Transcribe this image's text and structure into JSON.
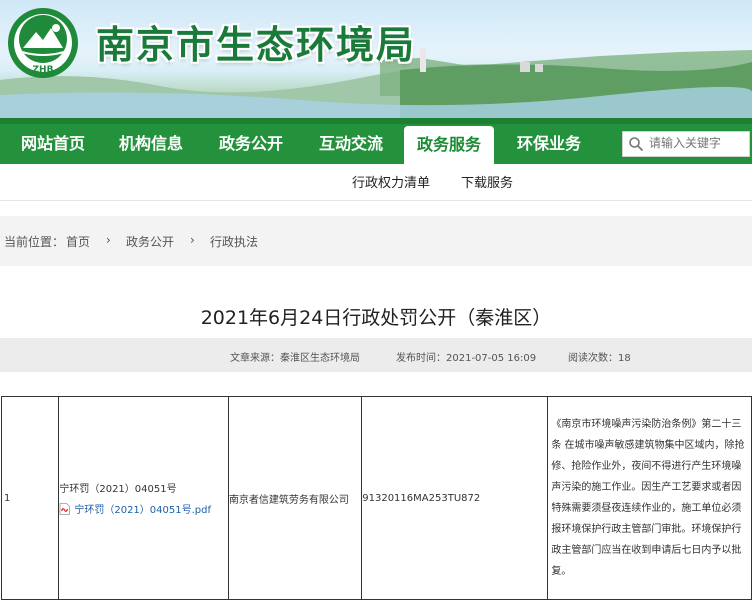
{
  "header": {
    "title": "南京市生态环境局",
    "logo_text": "ZHB"
  },
  "nav": {
    "items": [
      {
        "label": "网站首页"
      },
      {
        "label": "机构信息"
      },
      {
        "label": "政务公开"
      },
      {
        "label": "互动交流"
      },
      {
        "label": "政务服务",
        "active": true
      },
      {
        "label": "环保业务"
      }
    ],
    "search_placeholder": "请输入关键字",
    "accent": "#24923c"
  },
  "subnav": {
    "items": [
      "行政权力清单",
      "下载服务"
    ]
  },
  "breadcrumb": {
    "prefix": "当前位置：",
    "items": [
      "首页",
      "政务公开",
      "行政执法"
    ],
    "sep": "›"
  },
  "article": {
    "title": "2021年6月24日行政处罚公开（秦淮区）",
    "source": "文章来源：秦淮区生态环境局",
    "published": "发布时间：2021-07-05 16:09",
    "views": "阅读次数：18"
  },
  "table": {
    "row": {
      "index": "1",
      "case_no": "宁环罚（2021）04051号",
      "attachment": "宁环罚（2021）04051号.pdf",
      "company": "南京者信建筑劳务有限公司",
      "credit_code": "91320116MA253TU872",
      "basis": "《南京市环境噪声污染防治条例》第二十三条 在城市噪声敏感建筑物集中区域内，除抢修、抢险作业外，夜间不得进行产生环境噪声污染的施工作业。因生产工艺要求或者因特殊需要须昼夜连续作业的，施工单位必须报环境保护行政主管部门审批。环境保护行政主管部门应当在收到申请后七日内予以批复。"
    }
  }
}
